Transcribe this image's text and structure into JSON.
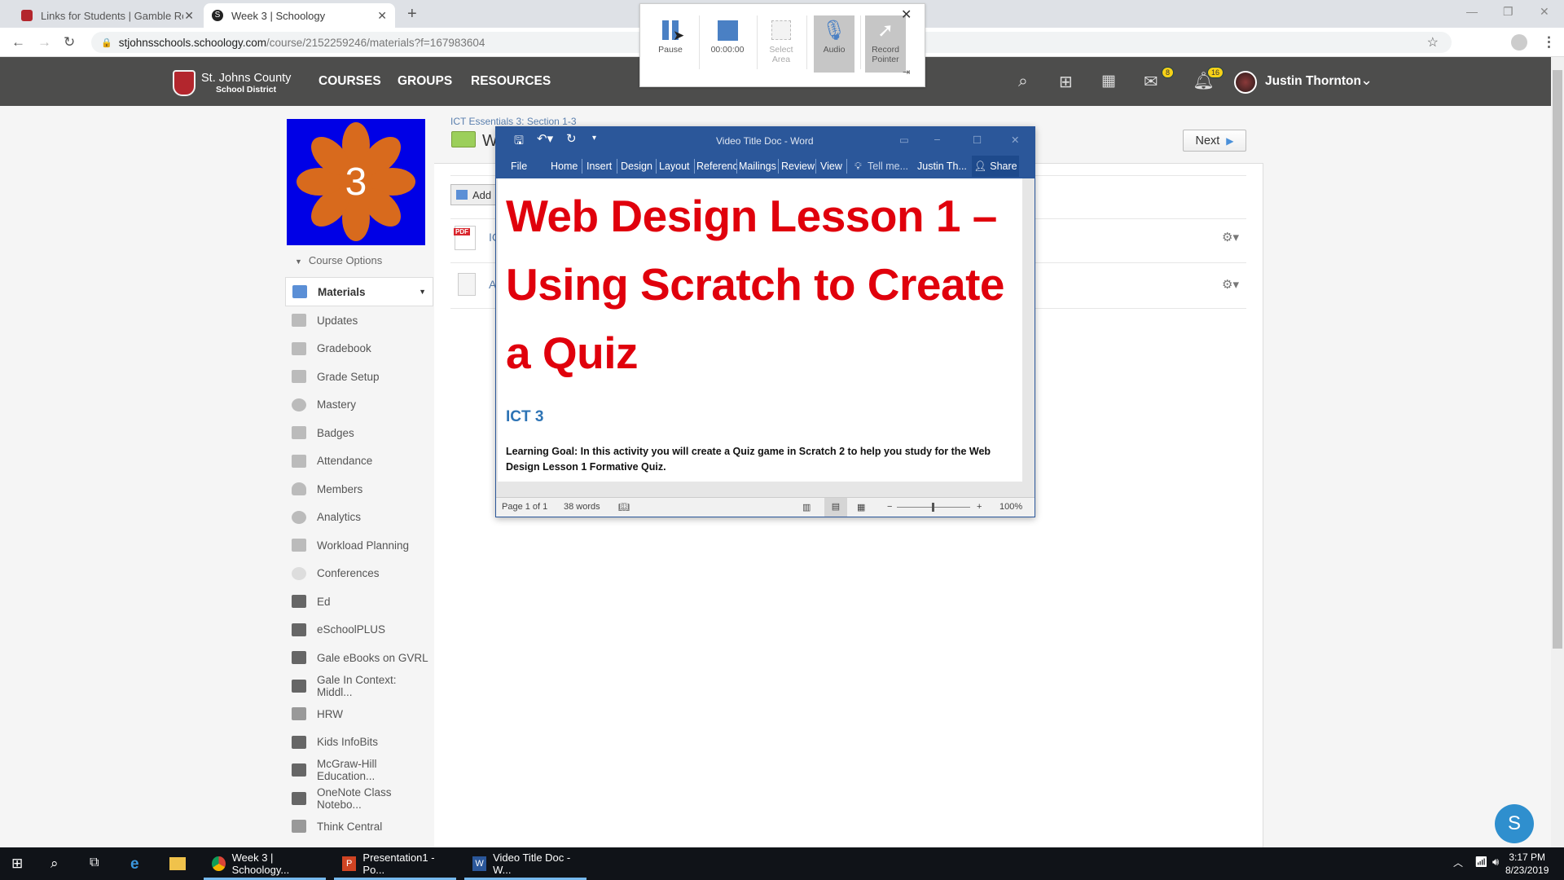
{
  "browser": {
    "tabs": [
      {
        "title": "Links for Students | Gamble Roge",
        "active": false
      },
      {
        "title": "Week 3 | Schoology",
        "active": true
      }
    ],
    "url_host": "stjohnsschools.schoology.com",
    "url_path": "/course/2152259246/materials?f=167983604"
  },
  "header": {
    "org_name": "St. Johns County",
    "org_sub": "School District",
    "nav": [
      "COURSES",
      "GROUPS",
      "RESOURCES"
    ],
    "mail_badge": "8",
    "notif_badge": "16",
    "user_name": "Justin Thornton"
  },
  "course": {
    "image_number": "3",
    "image_bg": "#0000e6",
    "image_flower": "#d86a1d",
    "options_label": "Course Options"
  },
  "sidebar": {
    "items": [
      {
        "label": "Materials",
        "active": true
      },
      {
        "label": "Updates"
      },
      {
        "label": "Gradebook"
      },
      {
        "label": "Grade Setup"
      },
      {
        "label": "Mastery"
      },
      {
        "label": "Badges"
      },
      {
        "label": "Attendance"
      },
      {
        "label": "Members"
      },
      {
        "label": "Analytics"
      },
      {
        "label": "Workload Planning"
      },
      {
        "label": "Conferences"
      },
      {
        "label": "Ed"
      },
      {
        "label": "eSchoolPLUS"
      },
      {
        "label": "Gale eBooks on GVRL"
      },
      {
        "label": "Gale In Context: Middl..."
      },
      {
        "label": "HRW"
      },
      {
        "label": "Kids InfoBits"
      },
      {
        "label": "McGraw-Hill Education..."
      },
      {
        "label": "OneNote Class Notebo..."
      },
      {
        "label": "Think Central"
      }
    ]
  },
  "main": {
    "breadcrumb": "ICT Essentials 3: Section 1-3",
    "folder_title": "W",
    "next_label": "Next",
    "add_label": "Add",
    "items": [
      {
        "type": "pdf",
        "title": "IC"
      },
      {
        "type": "doc",
        "title": "A"
      }
    ]
  },
  "recorder": {
    "pause_label": "Pause",
    "timer": "00:00:00",
    "select_area_label": "Select Area",
    "audio_label": "Audio",
    "record_pointer_label": "Record Pointer"
  },
  "word": {
    "title": "Video Title Doc - Word",
    "ribbon_tabs": [
      "File",
      "Home",
      "Insert",
      "Design",
      "Layout",
      "Referenc",
      "Mailings",
      "Review",
      "View"
    ],
    "tell_me": "Tell me...",
    "user": "Justin Th...",
    "share": "Share",
    "heading": "Web Design Lesson 1 – Using Scratch to Create a Quiz",
    "subheading": "ICT 3",
    "paragraph": "Learning Goal:  In this activity you will create a Quiz game in Scratch 2 to help you study for the Web Design Lesson 1 Formative Quiz.",
    "status_page": "Page 1 of 1",
    "status_words": "38 words",
    "zoom": "100%"
  },
  "taskbar": {
    "apps": [
      "Week 3 | Schoology...",
      "Presentation1 - Po...",
      "Video Title Doc - W..."
    ],
    "time": "3:17 PM",
    "date": "8/23/2019"
  },
  "chat_bubble": "S"
}
